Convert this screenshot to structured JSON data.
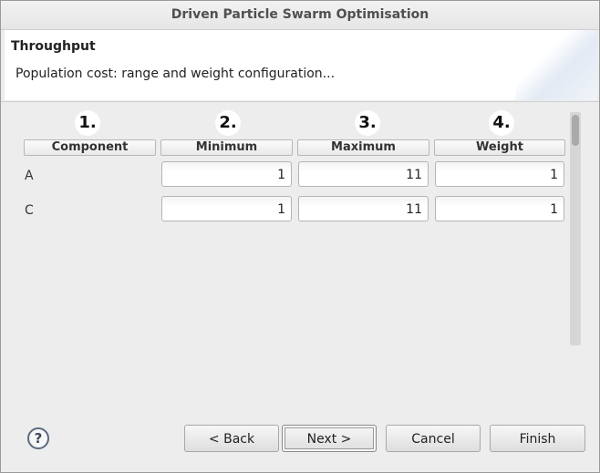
{
  "window": {
    "title": "Driven Particle Swarm Optimisation"
  },
  "banner": {
    "title": "Throughput",
    "description": "Population cost: range and weight configuration..."
  },
  "table": {
    "column_numbers": [
      "1.",
      "2.",
      "3.",
      "4."
    ],
    "headers": [
      "Component",
      "Minimum",
      "Maximum",
      "Weight"
    ],
    "rows": [
      {
        "label": "A",
        "minimum": "1",
        "maximum": "11",
        "weight": "1"
      },
      {
        "label": "C",
        "minimum": "1",
        "maximum": "11",
        "weight": "1"
      }
    ]
  },
  "buttons": {
    "help": "?",
    "back": "< Back",
    "next": "Next >",
    "cancel": "Cancel",
    "finish": "Finish"
  },
  "icons": {
    "help": "help-icon"
  }
}
